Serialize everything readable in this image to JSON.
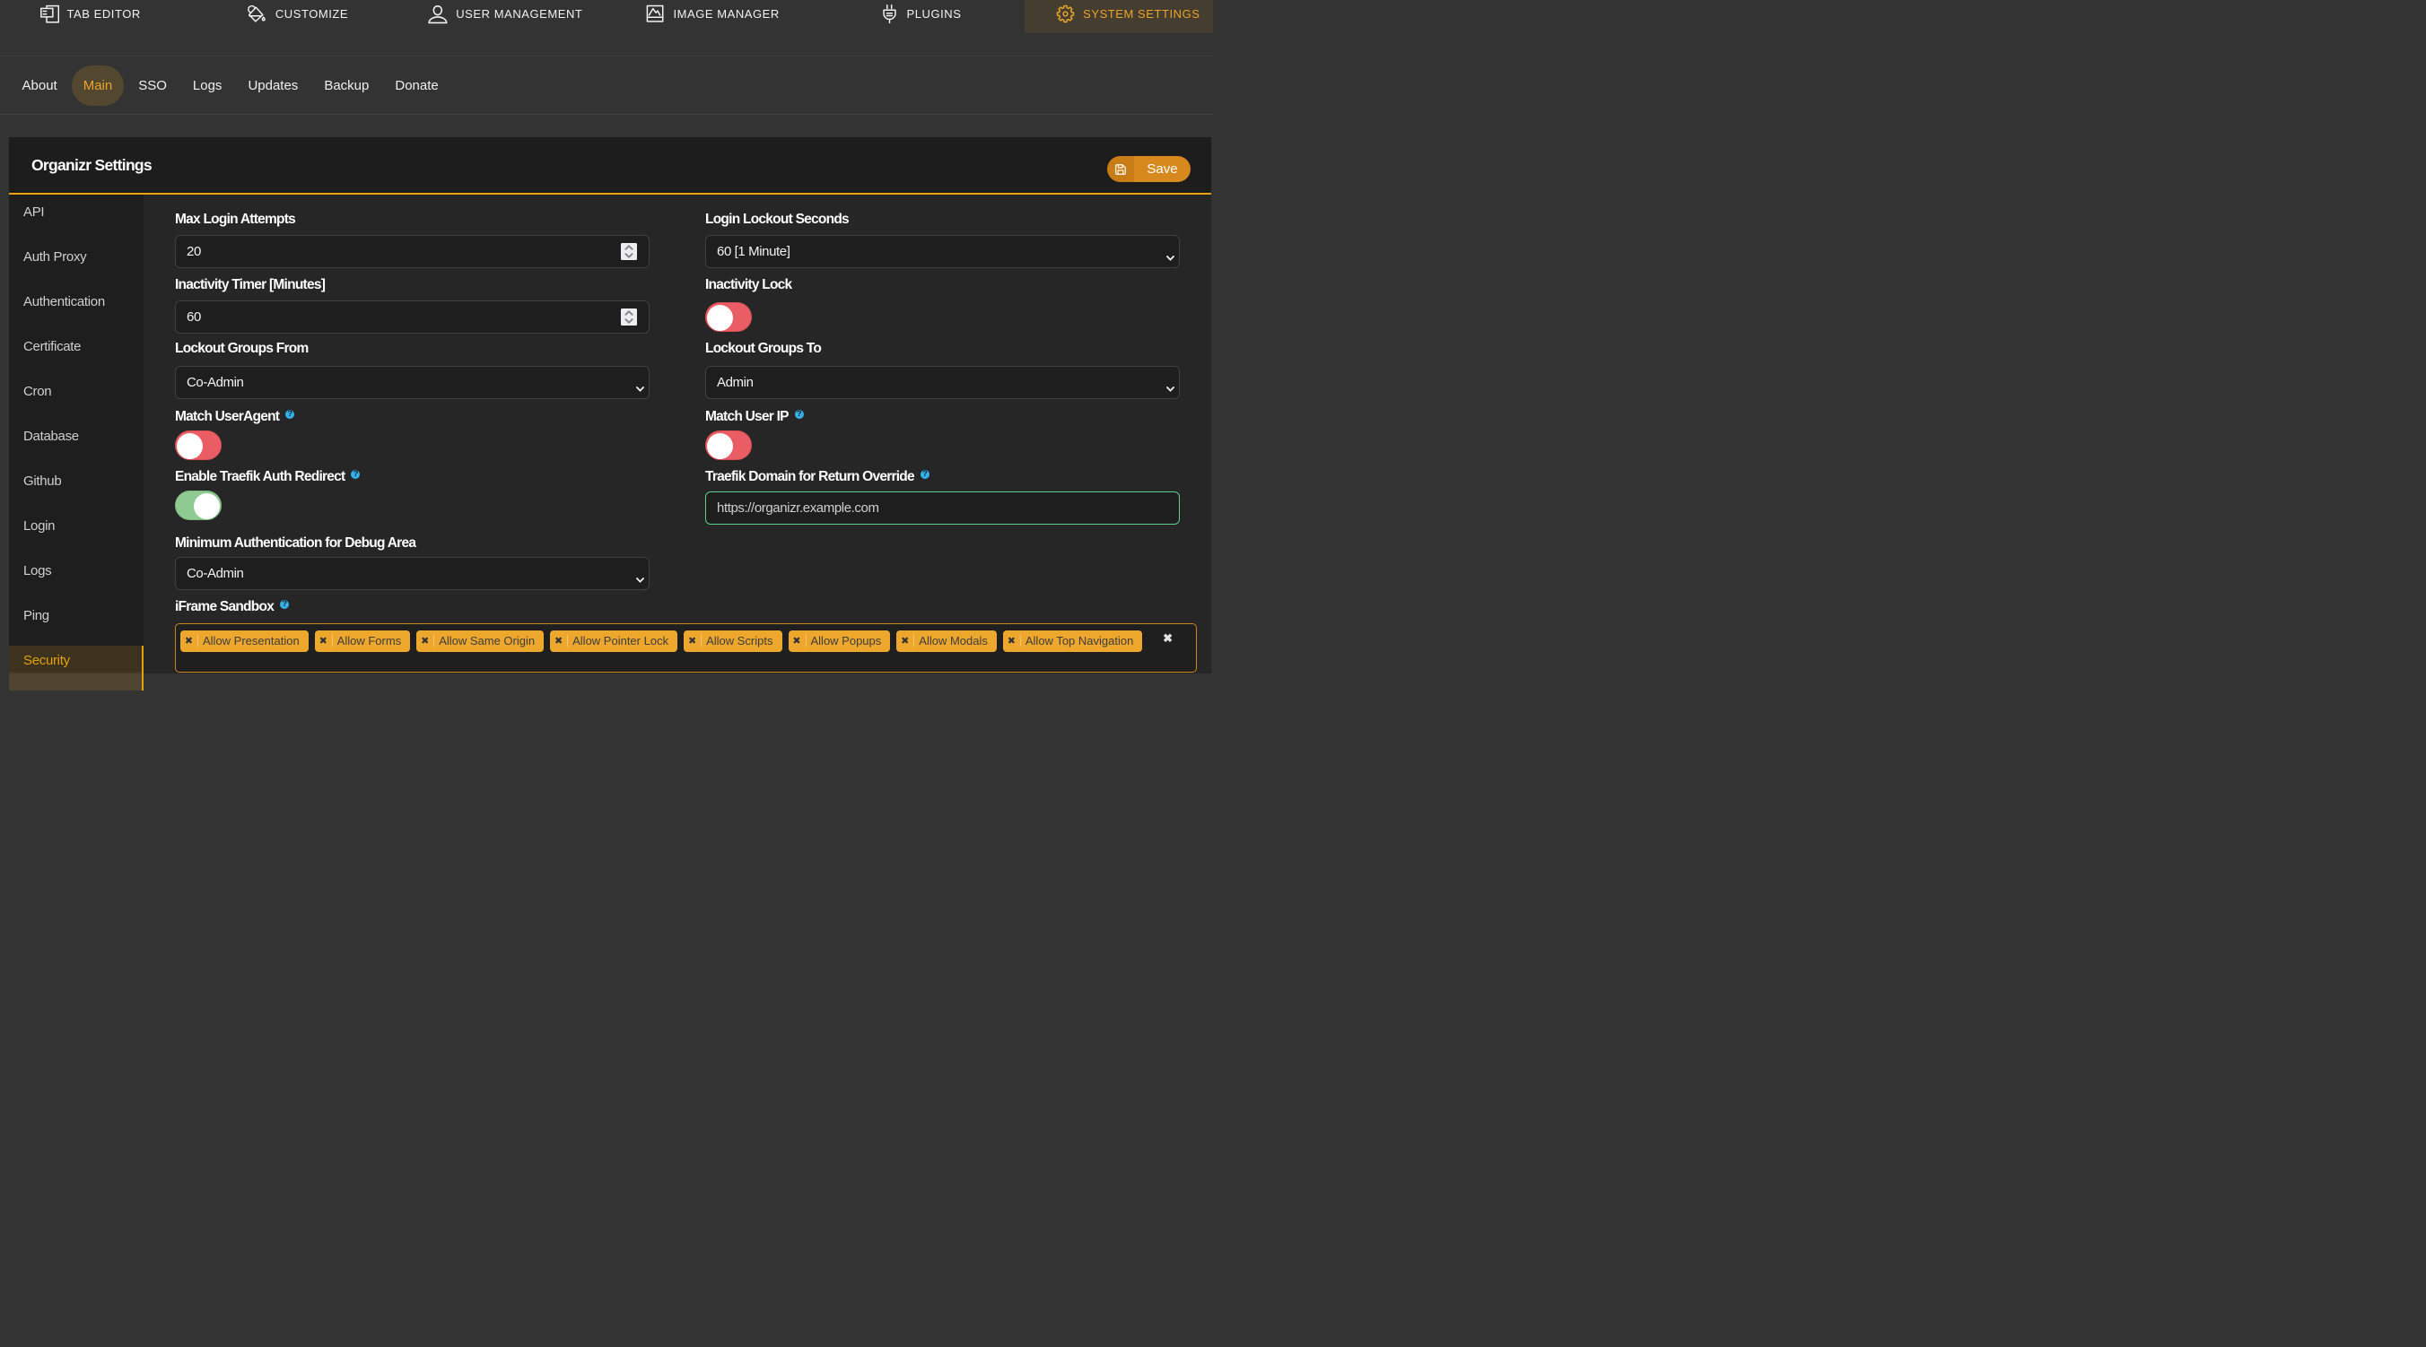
{
  "topnav": {
    "items": [
      {
        "label": "TAB EDITOR",
        "icon": "tab-editor-icon",
        "active": false
      },
      {
        "label": "CUSTOMIZE",
        "icon": "paint-bucket-icon",
        "active": false
      },
      {
        "label": "USER MANAGEMENT",
        "icon": "user-icon",
        "active": false
      },
      {
        "label": "IMAGE MANAGER",
        "icon": "image-icon",
        "active": false
      },
      {
        "label": "PLUGINS",
        "icon": "plug-icon",
        "active": false
      },
      {
        "label": "SYSTEM SETTINGS",
        "icon": "gear-icon",
        "active": true
      }
    ]
  },
  "tabs": {
    "items": [
      {
        "label": "About",
        "active": false
      },
      {
        "label": "Main",
        "active": true
      },
      {
        "label": "SSO",
        "active": false
      },
      {
        "label": "Logs",
        "active": false
      },
      {
        "label": "Updates",
        "active": false
      },
      {
        "label": "Backup",
        "active": false
      },
      {
        "label": "Donate",
        "active": false
      }
    ]
  },
  "panel": {
    "title": "Organizr Settings",
    "save_label": "Save"
  },
  "sidebar": {
    "items": [
      {
        "label": "API",
        "active": false
      },
      {
        "label": "Auth Proxy",
        "active": false
      },
      {
        "label": "Authentication",
        "active": false
      },
      {
        "label": "Certificate",
        "active": false
      },
      {
        "label": "Cron",
        "active": false
      },
      {
        "label": "Database",
        "active": false
      },
      {
        "label": "Github",
        "active": false
      },
      {
        "label": "Login",
        "active": false
      },
      {
        "label": "Logs",
        "active": false
      },
      {
        "label": "Ping",
        "active": false
      },
      {
        "label": "Security",
        "active": true
      }
    ]
  },
  "form": {
    "left": [
      {
        "label": "Max Login Attempts",
        "type": "number",
        "value": "20"
      },
      {
        "label": "Inactivity Timer [Minutes]",
        "type": "number",
        "value": "60"
      },
      {
        "label": "Lockout Groups From",
        "type": "select",
        "value": "Co-Admin"
      },
      {
        "label": "Match UserAgent",
        "help": true,
        "type": "toggle",
        "state": "off"
      },
      {
        "label": "Enable Traefik Auth Redirect",
        "help": true,
        "type": "toggle",
        "state": "on"
      },
      {
        "label": "Minimum Authentication for Debug Area",
        "type": "select",
        "value": "Co-Admin"
      },
      {
        "label": "iFrame Sandbox",
        "help": true,
        "type": "tags",
        "tags": [
          "Allow Presentation",
          "Allow Forms",
          "Allow Same Origin",
          "Allow Pointer Lock",
          "Allow Scripts",
          "Allow Popups",
          "Allow Modals",
          "Allow Top Navigation"
        ],
        "remove_icon": "x-icon",
        "clear_icon": "clear-all-x-icon"
      }
    ],
    "right": [
      {
        "label": "Login Lockout Seconds",
        "type": "select",
        "value": "60 [1 Minute]"
      },
      {
        "label": "Inactivity Lock",
        "type": "toggle",
        "state": "off"
      },
      {
        "label": "Lockout Groups To",
        "type": "select",
        "value": "Admin"
      },
      {
        "label": "Match User IP",
        "help": true,
        "type": "toggle",
        "state": "off"
      },
      {
        "label": "Traefik Domain for Return Override",
        "help": true,
        "type": "text",
        "value": "https://organizr.example.com",
        "highlight": "green"
      }
    ]
  },
  "colors": {
    "accent": "#e5a00d",
    "toggle_on": "#90ca93",
    "toggle_off": "#ea5d64",
    "help_badge": "#28a9e0",
    "chip": "#eea72d",
    "save_button": "#d8891d"
  }
}
